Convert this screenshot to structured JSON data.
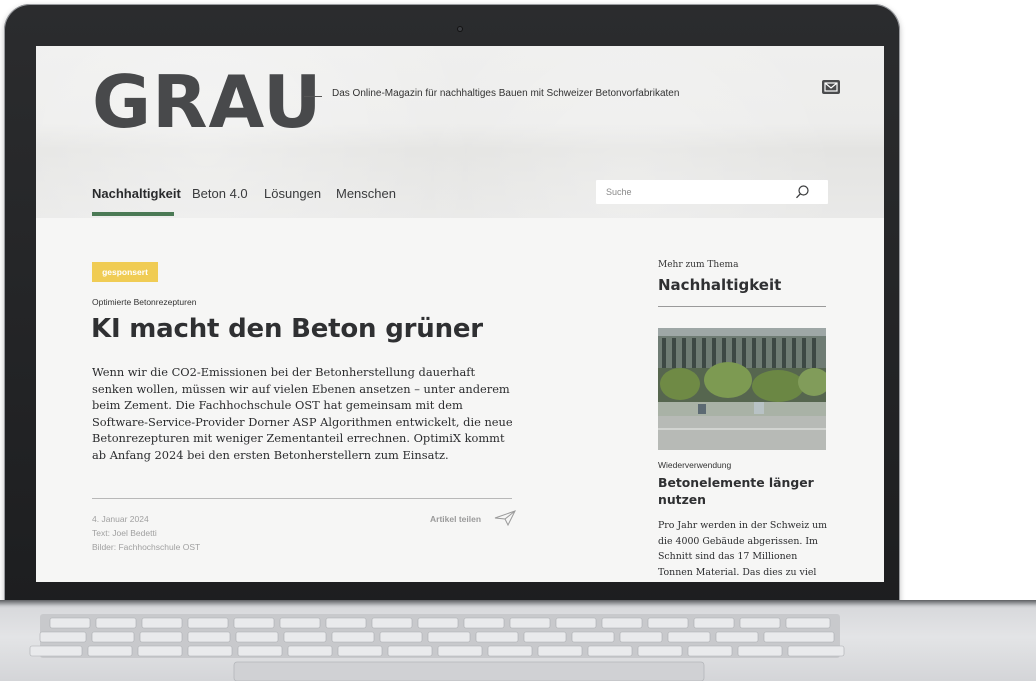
{
  "header": {
    "logo": "GRAU",
    "tagline": "Das Online-Magazin für nachhaltiges Bauen mit Schweizer Betonvorfabrikaten",
    "mail_icon": "mail-icon"
  },
  "nav": {
    "items": [
      {
        "label": "Nachhaltigkeit",
        "active": true
      },
      {
        "label": "Beton 4.0",
        "active": false
      },
      {
        "label": "Lösungen",
        "active": false
      },
      {
        "label": "Menschen",
        "active": false
      }
    ],
    "accent_color": "#4b7a55"
  },
  "search": {
    "placeholder": "Suche",
    "icon": "search-icon"
  },
  "article": {
    "badge": "gesponsert",
    "badge_color": "#f0cc54",
    "kicker": "Optimierte Betonrezepturen",
    "headline": "KI macht den Beton grüner",
    "lead": "Wenn wir die CO2-Emissionen bei der Betonherstellung dauerhaft senken wollen, müssen wir auf vielen Ebenen ansetzen – unter anderem beim Zement. Die Fachhochschule OST hat gemeinsam mit dem Software-Service-Provider Dorner ASP Algorithmen entwickelt, die neue Betonrezepturen mit weniger Zementanteil errechnen. OptimiX kommt ab Anfang 2024 bei den ersten Betonherstellern zum Einsatz.",
    "date": "4. Januar 2024",
    "text_credit": "Text: Joel Bedetti",
    "image_credit": "Bilder: Fachhochschule OST",
    "share_label": "Artikel teilen",
    "share_icon": "paper-plane-icon"
  },
  "sidebar": {
    "kicker": "Mehr zum Thema",
    "title": "Nachhaltigkeit",
    "card": {
      "kicker": "Wiederverwendung",
      "title": "Betonelemente länger nutzen",
      "text": "Pro Jahr werden in der Schweiz um die 4000 Gebäude abgerissen. Im Schnitt sind das 17 Millionen Tonnen Material. Das dies zu viel"
    }
  }
}
